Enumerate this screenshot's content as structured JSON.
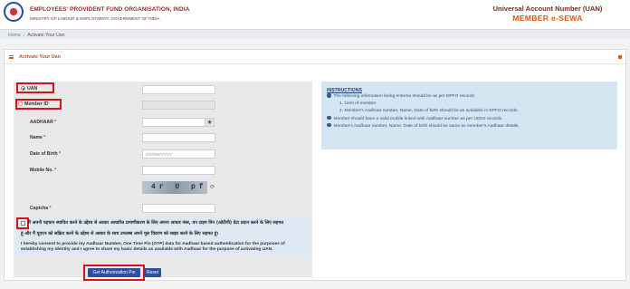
{
  "header": {
    "org_name": "EMPLOYEES' PROVIDENT FUND ORGANISATION, INDIA",
    "ministry": "MINISTRY OF LABOUR & EMPLOYMENT, GOVERNMENT OF INDIA",
    "uan_title": "Universal Account Number (UAN)",
    "portal_title": "MEMBER e-SEWA"
  },
  "breadcrumb": {
    "home": "Home",
    "separator": "/",
    "current": "Activate Your Uan"
  },
  "panel": {
    "title": "Activate Your Uan"
  },
  "form": {
    "radio_uan": "UAN",
    "radio_member_id": "Member ID",
    "aadhaar_label": "AADHAAR",
    "name_label": "Name",
    "dob_label": "Date of Birth",
    "dob_placeholder": "DD/MM/YYYY",
    "mobile_label": "Mobile No.",
    "captcha_label": "Captcha",
    "captcha_text": "4r U pf",
    "required_mark": "*",
    "consent_hindi_1": "मैं अपनी पहचान स्थापित करने के उद्देश्य से आधार आधारित प्रमाणीकरण के लिए अपना आधार नंबर, वन टाइम पिन (ओटीपी) डेटा प्रदान करने के लिए सहमत",
    "consent_hindi_2": "हूं और मैं यूएएन को सक्रिय करने के उद्देश्य से आधार के साथ उपलब्ध अपने मूल विवरण को साझा करने के लिए सहमत हूं।",
    "consent_english": "I hereby consent to provide my Aadhaar Number, One Time Pin (OTP) data for Aadhaar based authentication for the purposes of establishing my identity and I agree to share my basic details as available with Aadhaar for the purpose of activating UAN.",
    "get_pin_button": "Get Authorization Pin",
    "reset_button": "Reset"
  },
  "instructions": {
    "title": "INSTRUCTIONS",
    "line1": "The following information being entered should be as per EPFO records",
    "sub1": "1. UAN of member",
    "sub2": "2. Member's Aadhaar number, Name, Date of birth should be as available in EPFO records.",
    "line2": "Member should have a valid mobile linked with Aadhaar number as per UIDAI records.",
    "line3": "Member's Aadhaar number, Name, Date of birth should be same as member's Aadhaar details."
  },
  "colors": {
    "highlight": "#d6131b",
    "button": "#2e4fa0",
    "accent": "#d45a1a",
    "info_bg": "#d3e6f1"
  },
  "icons": {
    "logo": "epfo-logo-icon",
    "eye": "eye-icon",
    "refresh": "refresh-icon",
    "menu": "hamburger-icon"
  }
}
